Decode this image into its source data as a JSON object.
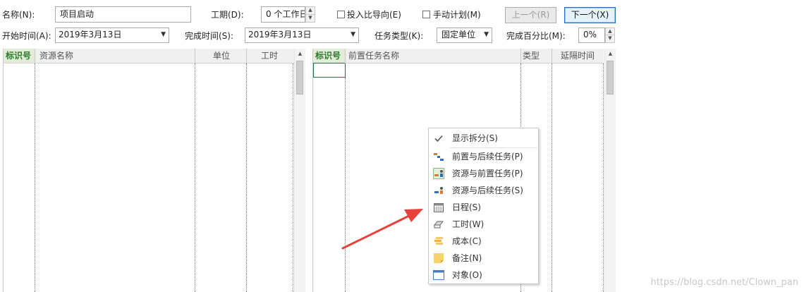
{
  "form": {
    "name_label": "名称(N):",
    "name_value": "项目启动",
    "duration_label": "工期(D):",
    "duration_value": "0 个工作日",
    "effort_driven_label": "投入比导向(E)",
    "manual_label": "手动计划(M)",
    "prev_button": "上一个(R)",
    "next_button": "下一个(X)",
    "start_label": "开始时间(A):",
    "start_value": "2019年3月13日",
    "finish_label": "完成时间(S):",
    "finish_value": "2019年3月13日",
    "task_type_label": "任务类型(K):",
    "task_type_value": "固定单位",
    "percent_label": "完成百分比(M):",
    "percent_value": "0%"
  },
  "left_grid": {
    "columns": [
      "标识号",
      "资源名称",
      "单位",
      "工时"
    ]
  },
  "right_grid": {
    "columns": [
      "标识号",
      "前置任务名称",
      "类型",
      "延隔时间"
    ]
  },
  "context_menu": {
    "items": [
      {
        "label": "显示拆分(S)",
        "icon": "check-icon",
        "checked": true
      },
      {
        "label": "前置与后续任务(P)",
        "icon": "predecessors-successors-icon"
      },
      {
        "label": "资源与前置任务(P)",
        "icon": "resources-predecessors-icon"
      },
      {
        "label": "资源与后续任务(S)",
        "icon": "resources-successors-icon"
      },
      {
        "label": "日程(S)",
        "icon": "schedule-icon"
      },
      {
        "label": "工时(W)",
        "icon": "work-icon"
      },
      {
        "label": "成本(C)",
        "icon": "cost-icon"
      },
      {
        "label": "备注(N)",
        "icon": "notes-icon"
      },
      {
        "label": "对象(O)",
        "icon": "objects-icon"
      }
    ]
  },
  "annotation": {
    "arrow_color": "#e8403a"
  },
  "watermark": "https://blog.csdn.net/Clown_pan",
  "colors": {
    "accent_green": "#2a7a2a",
    "button_border": "#2b6fb8"
  }
}
